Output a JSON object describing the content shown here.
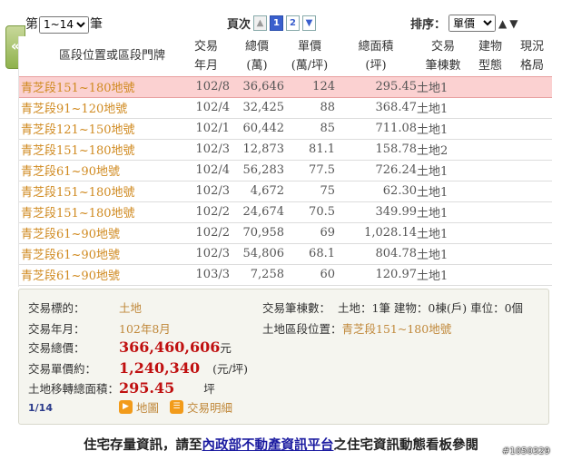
{
  "paging": {
    "prefix": "第",
    "range": "1~14",
    "suffix": "筆",
    "page_label": "頁次",
    "prev_icon": "▲",
    "pages": [
      "1",
      "2"
    ],
    "next_icon": "▼",
    "sort_label": "排序：",
    "sort_value": "單價",
    "sort_up": "▲",
    "sort_down": "▼"
  },
  "side_tab": {
    "icon": "«"
  },
  "table": {
    "headers": {
      "location": "區段位置或區段門牌",
      "ym": [
        "交易",
        "年月"
      ],
      "total": [
        "總價",
        "(萬)"
      ],
      "unit": [
        "單價",
        "(萬/坪)"
      ],
      "area": [
        "總面積",
        "(坪)"
      ],
      "count": [
        "交易",
        "筆棟數"
      ],
      "building": [
        "建物",
        "型態"
      ],
      "layout": [
        "現況",
        "格局"
      ]
    },
    "rows": [
      {
        "loc": "青芝段151~180地號",
        "ym": "102/8",
        "total": "36,646",
        "unit": "124",
        "area": "295.45",
        "count": "土地1"
      },
      {
        "loc": "青芝段91~120地號",
        "ym": "102/4",
        "total": "32,425",
        "unit": "88",
        "area": "368.47",
        "count": "土地1"
      },
      {
        "loc": "青芝段121~150地號",
        "ym": "102/1",
        "total": "60,442",
        "unit": "85",
        "area": "711.08",
        "count": "土地1"
      },
      {
        "loc": "青芝段151~180地號",
        "ym": "102/3",
        "total": "12,873",
        "unit": "81.1",
        "area": "158.78",
        "count": "土地2"
      },
      {
        "loc": "青芝段61~90地號",
        "ym": "102/4",
        "total": "56,283",
        "unit": "77.5",
        "area": "726.24",
        "count": "土地1"
      },
      {
        "loc": "青芝段151~180地號",
        "ym": "102/3",
        "total": "4,672",
        "unit": "75",
        "area": "62.30",
        "count": "土地1"
      },
      {
        "loc": "青芝段151~180地號",
        "ym": "102/2",
        "total": "24,674",
        "unit": "70.5",
        "area": "349.99",
        "count": "土地1"
      },
      {
        "loc": "青芝段61~90地號",
        "ym": "102/2",
        "total": "70,958",
        "unit": "69",
        "area": "1,028.14",
        "count": "土地1"
      },
      {
        "loc": "青芝段61~90地號",
        "ym": "102/3",
        "total": "54,806",
        "unit": "68.1",
        "area": "804.78",
        "count": "土地1"
      },
      {
        "loc": "青芝段61~90地號",
        "ym": "103/3",
        "total": "7,258",
        "unit": "60",
        "area": "120.97",
        "count": "土地1"
      }
    ]
  },
  "detail": {
    "type_label": "交易標的：",
    "type_value": "土地",
    "ym_label": "交易年月：",
    "ym_value": "102年8月",
    "total_label": "交易總價：",
    "total_value": "366,460,606",
    "total_unit": "元",
    "unit_label": "交易單價約：",
    "unit_value": "1,240,340",
    "unit_unit": "(元/坪)",
    "area_label": "土地移轉總面積：",
    "area_value": "295.45",
    "area_unit": "坪",
    "count_label": "交易筆棟數：",
    "count_value": "土地：1筆 建物：0棟(戶) 車位：0個",
    "section_label": "土地區段位置：",
    "section_value": "青芝段151~180地號",
    "page": "1/14",
    "map_icon": "▶",
    "map_label": "地圖",
    "detail_icon": "☰",
    "detail_label": "交易明細"
  },
  "footer": {
    "before": "住宅存量資訊，請至",
    "link": "內政部不動產資訊平台",
    "after": "之住宅資訊動態看板參閱"
  },
  "stamp": "#1050329"
}
